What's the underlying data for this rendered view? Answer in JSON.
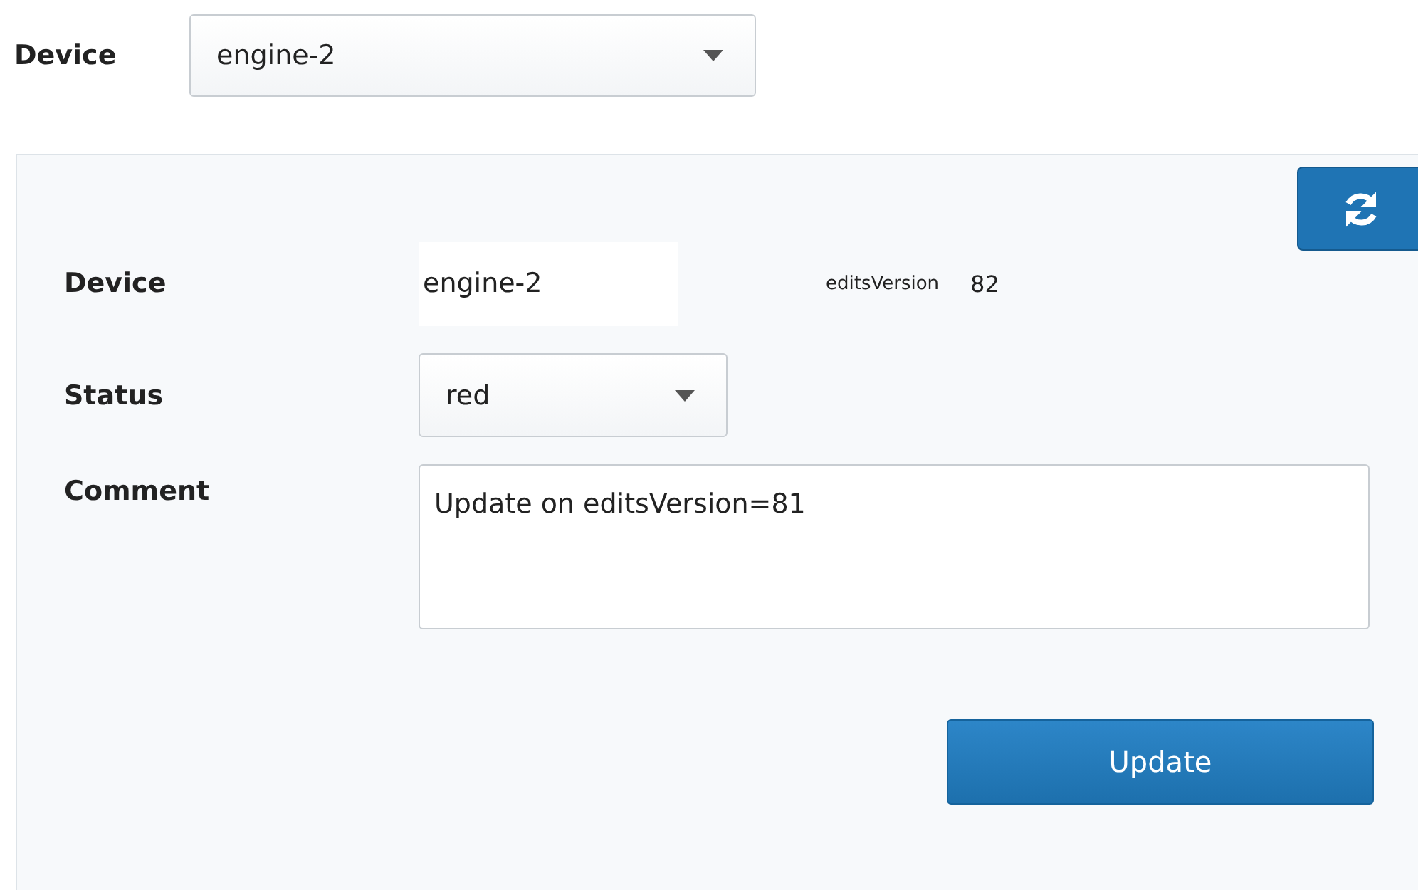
{
  "device_picker": {
    "label": "Device",
    "value": "engine-2"
  },
  "panel": {
    "device": {
      "label": "Device",
      "value": "engine-2"
    },
    "edits_version": {
      "label": "editsVersion",
      "value": "82"
    },
    "status": {
      "label": "Status",
      "value": "red"
    },
    "comment": {
      "label": "Comment",
      "value": "Update on editsVersion=81"
    },
    "update_button": {
      "label": "Update"
    }
  }
}
